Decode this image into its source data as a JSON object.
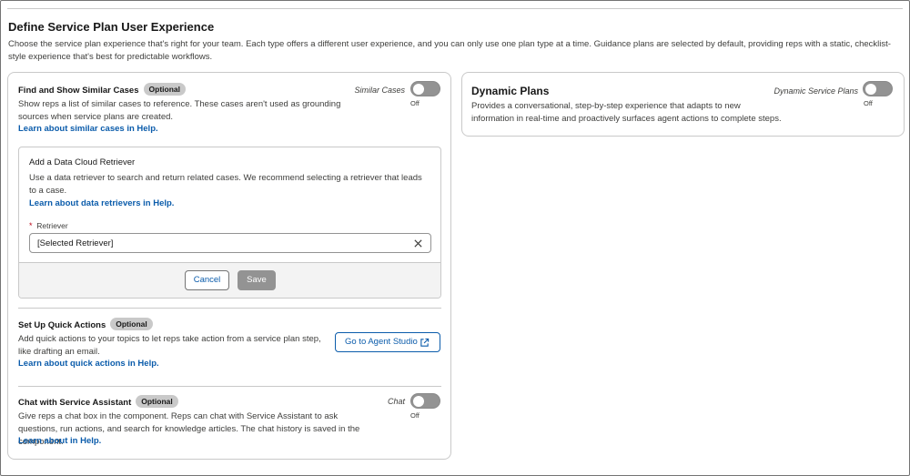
{
  "page": {
    "title": "Define Service Plan User Experience",
    "description": "Choose the service plan experience that's right for your team. Each type offers a different user experience, and you can only use one plan type at a time. Guidance plans are selected by default, providing reps with a static, checklist-style experience that's best for predictable workflows."
  },
  "similar_cases": {
    "title": "Find and Show Similar Cases",
    "badge": "Optional",
    "description": "Show reps a list of similar cases to reference. These cases aren't used as grounding sources when service plans are created.",
    "link": "Learn about similar cases in Help.",
    "toggle_label": "Similar Cases",
    "toggle_state": "Off",
    "retriever_box": {
      "title": "Add a Data Cloud Retriever",
      "description": "Use a data retriever to search and return related cases. We recommend selecting a retriever that leads to a case.",
      "link": "Learn about data retrievers in Help.",
      "required_mark": "*",
      "field_label": "Retriever",
      "field_value": "[Selected Retriever]",
      "cancel": "Cancel",
      "save": "Save"
    }
  },
  "quick_actions": {
    "title": "Set Up Quick Actions",
    "badge": "Optional",
    "description": "Add quick actions to your topics to let reps take action from a service plan step, like drafting an email.",
    "link": "Learn about quick actions in Help.",
    "button": "Go to Agent Studio"
  },
  "chat": {
    "title": "Chat with Service Assistant",
    "badge": "Optional",
    "description": "Give reps a chat box in the component. Reps can chat with Service Assistant to ask questions, run actions, and search for knowledge articles. The chat history is saved in the component.",
    "link": "Learn about in Help.",
    "toggle_label": "Chat",
    "toggle_state": "Off"
  },
  "dynamic_plans": {
    "title": "Dynamic Plans",
    "description": "Provides a conversational, step-by-step experience that adapts to new information in real-time and proactively surfaces agent actions to complete steps.",
    "toggle_label": "Dynamic Service Plans",
    "toggle_state": "Off"
  },
  "icons": {
    "clear": "close-icon",
    "external": "new-window-icon"
  },
  "colors": {
    "link": "#0b5cab",
    "toggle_off": "#939393",
    "badge": "#c9c9c9",
    "required": "#ba0517"
  }
}
